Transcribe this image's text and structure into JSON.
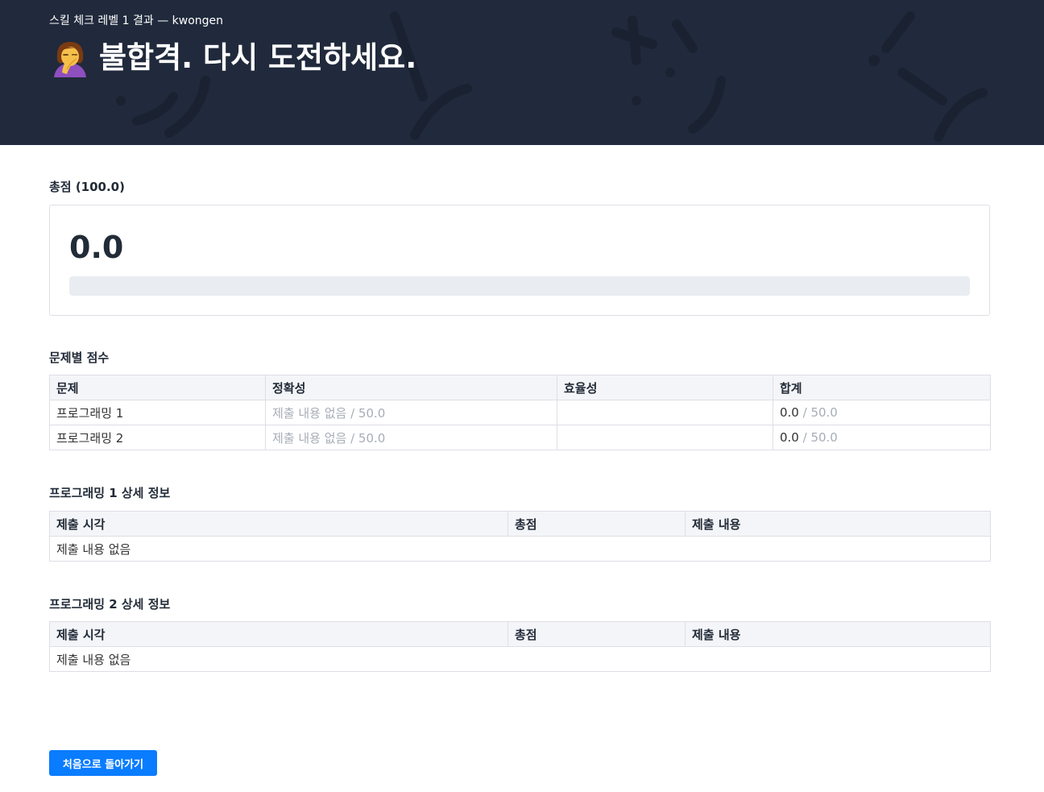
{
  "header": {
    "subtitle": "스킬 체크 레벨 1 결과 — kwongen",
    "title": "불합격. 다시 도전하세요.",
    "icon": "facepalm-person-icon"
  },
  "total": {
    "heading": "총점 (100.0)",
    "score": "0.0",
    "progress_fraction": 0
  },
  "problem_scores": {
    "heading": "문제별 점수",
    "columns": [
      "문제",
      "정확성",
      "효율성",
      "합계"
    ],
    "rows": [
      {
        "problem": "프로그래밍 1",
        "accuracy": "제출 내용 없음 / 50.0",
        "efficiency": "",
        "total": "0.0",
        "total_max": " / 50.0"
      },
      {
        "problem": "프로그래밍 2",
        "accuracy": "제출 내용 없음 / 50.0",
        "efficiency": "",
        "total": "0.0",
        "total_max": " / 50.0"
      }
    ]
  },
  "details": [
    {
      "heading": "프로그래밍 1 상세 정보",
      "columns": [
        "제출 시각",
        "총점",
        "제출 내용"
      ],
      "empty": "제출 내용 없음"
    },
    {
      "heading": "프로그래밍 2 상세 정보",
      "columns": [
        "제출 시각",
        "총점",
        "제출 내용"
      ],
      "empty": "제출 내용 없음"
    }
  ],
  "back_button": "처음으로 돌아가기",
  "colors": {
    "hero_bg": "#202a3c",
    "accent": "#0a7cff",
    "muted_text": "#a7adb6"
  }
}
